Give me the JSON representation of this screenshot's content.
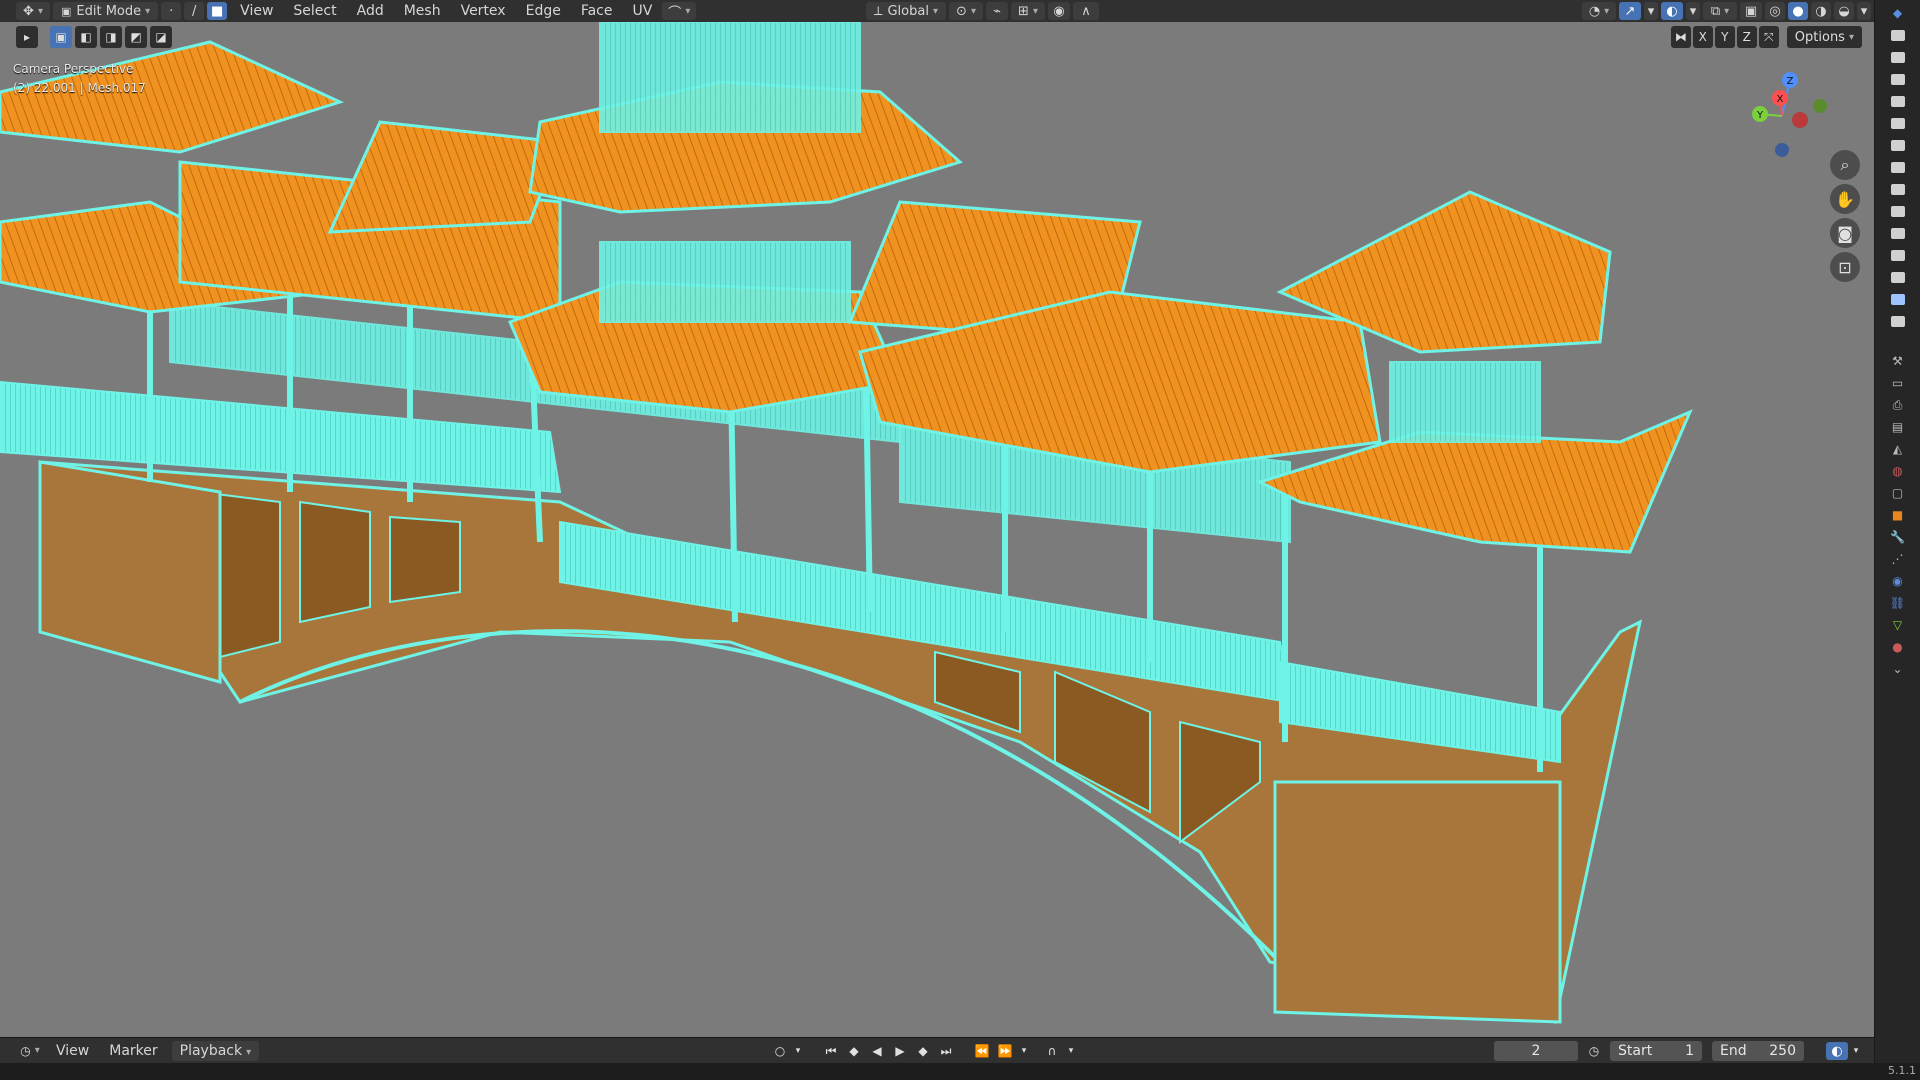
{
  "header": {
    "mode_label": "Edit Mode",
    "menus": [
      "View",
      "Select",
      "Add",
      "Mesh",
      "Vertex",
      "Edge",
      "Face",
      "UV"
    ],
    "transform_orientation": "Global"
  },
  "viewport": {
    "camera_label": "Camera Perspective",
    "object_info": "(2) 22.001 | Mesh.017",
    "axis_buttons": [
      "X",
      "Y",
      "Z"
    ],
    "options_label": "Options",
    "gizmo_axes": [
      "Z",
      "X",
      "Y"
    ]
  },
  "timeline": {
    "menus": [
      "View",
      "Marker"
    ],
    "playback_label": "Playback",
    "current_frame": "2",
    "start_label": "Start",
    "start_value": "1",
    "end_label": "End",
    "end_value": "250"
  },
  "status": {
    "version": "5.1.1"
  },
  "colors": {
    "accent": "#4772b3",
    "selected_face": "#e8871e",
    "wire": "#5ff0e0"
  }
}
